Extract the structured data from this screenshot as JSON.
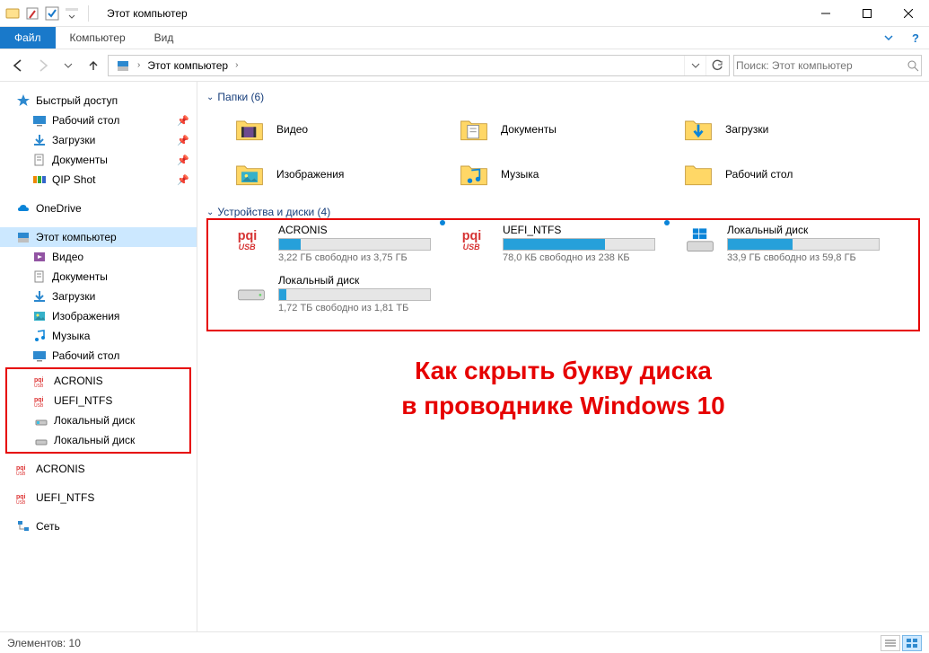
{
  "window": {
    "title": "Этот компьютер"
  },
  "ribbon": {
    "file": "Файл",
    "tab_computer": "Компьютер",
    "tab_view": "Вид"
  },
  "address": {
    "root": "Этот компьютер"
  },
  "search": {
    "placeholder": "Поиск: Этот компьютер"
  },
  "sidebar": {
    "quick_access": "Быстрый доступ",
    "desktop": "Рабочий стол",
    "downloads": "Загрузки",
    "documents": "Документы",
    "qip": "QIP Shot",
    "onedrive": "OneDrive",
    "this_pc": "Этот компьютер",
    "videos": "Видео",
    "documents2": "Документы",
    "downloads2": "Загрузки",
    "pictures": "Изображения",
    "music": "Музыка",
    "desktop2": "Рабочий стол",
    "acronis": "ACRONIS",
    "uefi": "UEFI_NTFS",
    "localdisk1": "Локальный диск",
    "localdisk2": "Локальный диск",
    "acronis2": "ACRONIS",
    "uefi2": "UEFI_NTFS",
    "network": "Сеть"
  },
  "groups": {
    "folders": "Папки (6)",
    "drives": "Устройства и диски (4)"
  },
  "folders": {
    "videos": "Видео",
    "documents": "Документы",
    "downloads": "Загрузки",
    "pictures": "Изображения",
    "music": "Музыка",
    "desktop": "Рабочий стол"
  },
  "drives": [
    {
      "name": "ACRONIS",
      "sub": "3,22 ГБ свободно из 3,75 ГБ",
      "pct": 14,
      "type": "usb"
    },
    {
      "name": "UEFI_NTFS",
      "sub": "78,0 КБ свободно из 238 КБ",
      "pct": 67,
      "type": "usb"
    },
    {
      "name": "Локальный диск",
      "sub": "33,9 ГБ свободно из 59,8 ГБ",
      "pct": 43,
      "type": "win"
    },
    {
      "name": "Локальный диск",
      "sub": "1,72 ТБ свободно из 1,81 ТБ",
      "pct": 5,
      "type": "hdd"
    }
  ],
  "annotation": {
    "line1": "Как скрыть букву диска",
    "line2": "в проводнике Windows 10"
  },
  "status": {
    "elements": "Элементов: 10"
  }
}
